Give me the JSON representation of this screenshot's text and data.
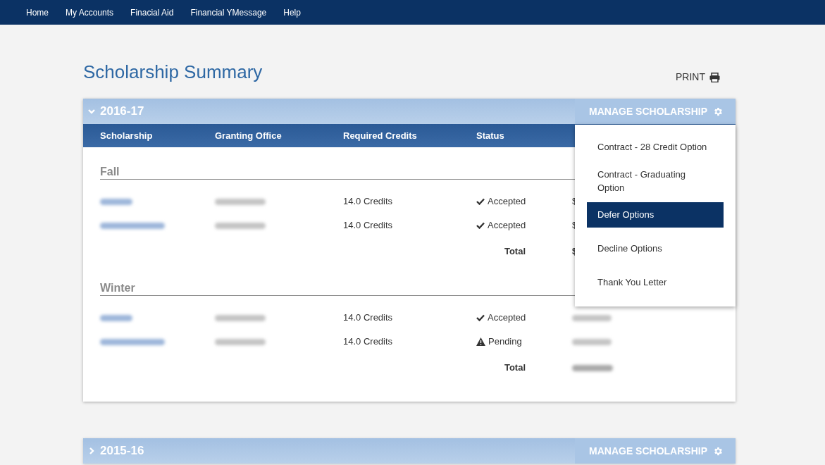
{
  "nav": [
    "Home",
    "My Accounts",
    "Finacial Aid",
    "Financial YMessage",
    "Help"
  ],
  "title": "Scholarship Summary",
  "print_label": "PRINT",
  "years": [
    {
      "label": "2016-17",
      "expanded": true,
      "manage_label": "MANAGE SCHOLARSHIP",
      "columns": [
        "Scholarship",
        "Granting Office",
        "Required Credits",
        "Status"
      ],
      "terms": [
        {
          "name": "Fall",
          "rows": [
            {
              "credits": "14.0 Credits",
              "status": {
                "kind": "accepted",
                "label": "Accepted"
              },
              "amount": "$"
            },
            {
              "credits": "14.0 Credits",
              "status": {
                "kind": "accepted",
                "label": "Accepted"
              },
              "amount": "$"
            }
          ],
          "total_label": "Total",
          "total": "$"
        },
        {
          "name": "Winter",
          "rows": [
            {
              "credits": "14.0 Credits",
              "status": {
                "kind": "accepted",
                "label": "Accepted"
              }
            },
            {
              "credits": "14.0 Credits",
              "status": {
                "kind": "pending",
                "label": "Pending"
              }
            }
          ],
          "total_label": "Total"
        }
      ],
      "menu": [
        {
          "label": "Contract - 28 Credit Option",
          "selected": false
        },
        {
          "label": "Contract - Graduating Option",
          "selected": false
        },
        {
          "label": "Defer Options",
          "selected": true
        },
        {
          "label": "Decline Options",
          "selected": false
        },
        {
          "label": "Thank You Letter",
          "selected": false
        }
      ]
    },
    {
      "label": "2015-16",
      "expanded": false,
      "manage_label": "MANAGE SCHOLARSHIP"
    }
  ]
}
